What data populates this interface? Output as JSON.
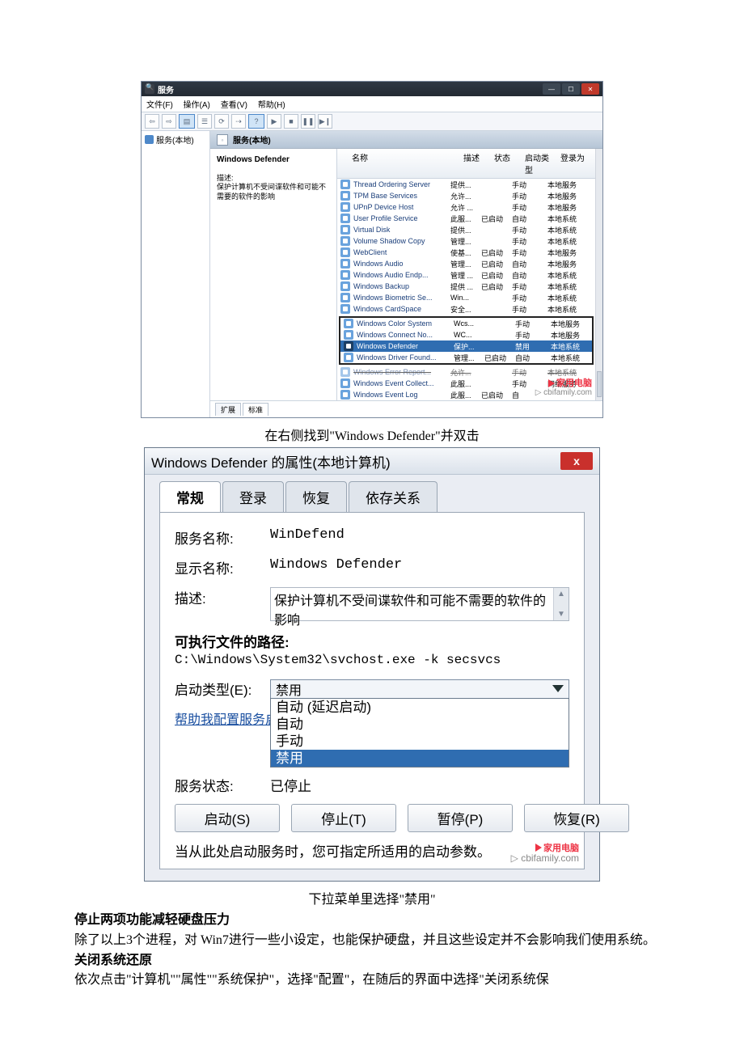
{
  "svc": {
    "window_title": "服务",
    "menus": [
      "文件(F)",
      "操作(A)",
      "查看(V)",
      "帮助(H)"
    ],
    "nav_item": "服务(本地)",
    "pane_title": "服务(本地)",
    "selected_name": "Windows Defender",
    "desc_label": "描述:",
    "desc_text": "保护计算机不受间谍软件和可能不需要的软件的影响",
    "headers": {
      "name": "名称",
      "desc": "描述",
      "stat": "状态",
      "start": "启动类型",
      "logon": "登录为"
    },
    "rows": [
      {
        "name": "Thread Ordering Server",
        "desc": "提供...",
        "stat": "",
        "start": "手动",
        "logon": "本地服务"
      },
      {
        "name": "TPM Base Services",
        "desc": "允许...",
        "stat": "",
        "start": "手动",
        "logon": "本地服务"
      },
      {
        "name": "UPnP Device Host",
        "desc": "允许 ...",
        "stat": "",
        "start": "手动",
        "logon": "本地服务"
      },
      {
        "name": "User Profile Service",
        "desc": "此服...",
        "stat": "已启动",
        "start": "自动",
        "logon": "本地系统"
      },
      {
        "name": "Virtual Disk",
        "desc": "提供...",
        "stat": "",
        "start": "手动",
        "logon": "本地系统"
      },
      {
        "name": "Volume Shadow Copy",
        "desc": "管理...",
        "stat": "",
        "start": "手动",
        "logon": "本地系统"
      },
      {
        "name": "WebClient",
        "desc": "使基...",
        "stat": "已启动",
        "start": "手动",
        "logon": "本地服务"
      },
      {
        "name": "Windows Audio",
        "desc": "管理...",
        "stat": "已启动",
        "start": "自动",
        "logon": "本地服务"
      },
      {
        "name": "Windows Audio Endp...",
        "desc": "管理 ...",
        "stat": "已启动",
        "start": "自动",
        "logon": "本地系统"
      },
      {
        "name": "Windows Backup",
        "desc": "提供 ...",
        "stat": "已启动",
        "start": "手动",
        "logon": "本地系统"
      },
      {
        "name": "Windows Biometric Se...",
        "desc": "Win...",
        "stat": "",
        "start": "手动",
        "logon": "本地系统"
      },
      {
        "name": "Windows CardSpace",
        "desc": "安全...",
        "stat": "",
        "start": "手动",
        "logon": "本地系统"
      }
    ],
    "box_rows": [
      {
        "name": "Windows Color System",
        "desc": "Wcs...",
        "stat": "",
        "start": "手动",
        "logon": "本地服务"
      },
      {
        "name": "Windows Connect No...",
        "desc": "WC...",
        "stat": "",
        "start": "手动",
        "logon": "本地服务"
      },
      {
        "name": "Windows Defender",
        "desc": "保护...",
        "stat": "",
        "start": "禁用",
        "logon": "本地系统",
        "sel": true
      },
      {
        "name": "Windows Driver Found...",
        "desc": "管理...",
        "stat": "已启动",
        "start": "自动",
        "logon": "本地系统"
      }
    ],
    "after_rows": [
      {
        "name": "Windows Error Report...",
        "desc": "允许...",
        "stat": "",
        "start": "手动",
        "logon": "本地系统",
        "cut": true
      },
      {
        "name": "Windows Event Collect...",
        "desc": "此服...",
        "stat": "",
        "start": "手动",
        "logon": "网络服务"
      },
      {
        "name": "Windows Event Log",
        "desc": "此服...",
        "stat": "已启动",
        "start": "自",
        "logon": ""
      }
    ],
    "tabs": [
      "扩展",
      "标准"
    ],
    "wm_line1": "家用电脑",
    "wm_line2": "cbifamily.com"
  },
  "cap1": "在右侧找到\"Windows Defender\"并双击",
  "prop": {
    "title": "Windows Defender 的属性(本地计算机)",
    "close": "x",
    "tabs": [
      "常规",
      "登录",
      "恢复",
      "依存关系"
    ],
    "field_service_name_label": "服务名称:",
    "field_service_name_value": "WinDefend",
    "field_display_name_label": "显示名称:",
    "field_display_name_value": "Windows Defender",
    "field_desc_label": "描述:",
    "field_desc_value": "保护计算机不受间谍软件和可能不需要的软件的影响",
    "exe_label": "可执行文件的路径:",
    "exe_path": "C:\\Windows\\System32\\svchost.exe -k secsvcs",
    "start_label": "启动类型(E):",
    "start_value": "禁用",
    "options": [
      "自动 (延迟启动)",
      "自动",
      "手动",
      "禁用"
    ],
    "help_link": "帮助我配置服务启",
    "status_label": "服务状态:",
    "status_value": "已停止",
    "buttons": [
      "启动(S)",
      "停止(T)",
      "暂停(P)",
      "恢复(R)"
    ],
    "hint": "当从此处启动服务时，您可指定所适用的启动参数。",
    "wm_line1": "家用电脑",
    "wm_line2": "cbifamily.com"
  },
  "cap2": "下拉菜单里选择\"禁用\"",
  "article": {
    "h1": "停止两项功能减轻硬盘压力",
    "p1": "除了以上3个进程，对 Win7进行一些小设定，也能保护硬盘，并且这些设定并不会影响我们使用系统。",
    "h2": "关闭系统还原",
    "p2": "依次点击\"计算机\"\"属性\"\"系统保护\"，选择\"配置\"，在随后的界面中选择\"关闭系统保"
  }
}
